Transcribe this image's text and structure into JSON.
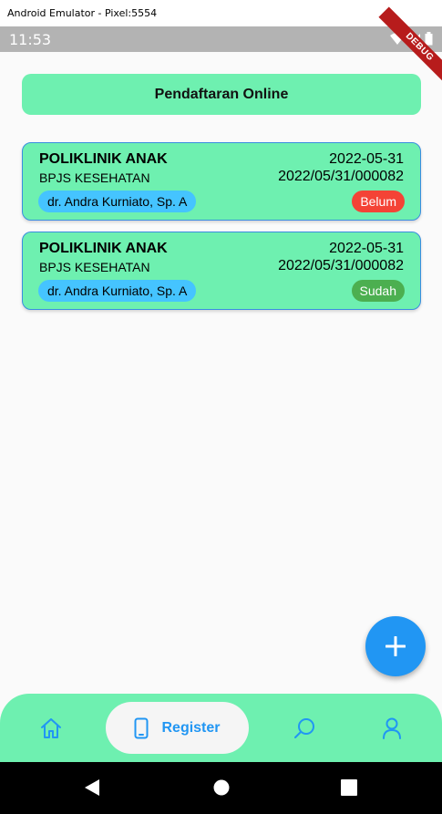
{
  "window": {
    "title": "Android Emulator - Pixel:5554"
  },
  "statusbar": {
    "time": "11:53",
    "debug_label": "DEBUG"
  },
  "header": {
    "label": "Pendaftaran Online"
  },
  "registrations": [
    {
      "clinic": "POLIKLINIK ANAK",
      "date": "2022-05-31",
      "payer": "BPJS KESEHATAN",
      "reg_no": "2022/05/31/000082",
      "doctor": "dr. Andra Kurniato, Sp. A",
      "status": "Belum",
      "status_color": "#f44336"
    },
    {
      "clinic": "POLIKLINIK ANAK",
      "date": "2022-05-31",
      "payer": "BPJS KESEHATAN",
      "reg_no": "2022/05/31/000082",
      "doctor": "dr. Andra Kurniato, Sp. A",
      "status": "Sudah",
      "status_color": "#4caf50"
    }
  ],
  "fab": {
    "icon": "plus-icon"
  },
  "bottom_nav": {
    "items": [
      {
        "icon": "home-icon",
        "label": ""
      },
      {
        "icon": "phone-icon",
        "label": "Register",
        "active": true
      },
      {
        "icon": "search-icon",
        "label": ""
      },
      {
        "icon": "person-icon",
        "label": ""
      }
    ]
  },
  "colors": {
    "accent": "#2196f3",
    "card_bg": "#6ef0b0",
    "doctor_chip": "#45c4ff"
  }
}
